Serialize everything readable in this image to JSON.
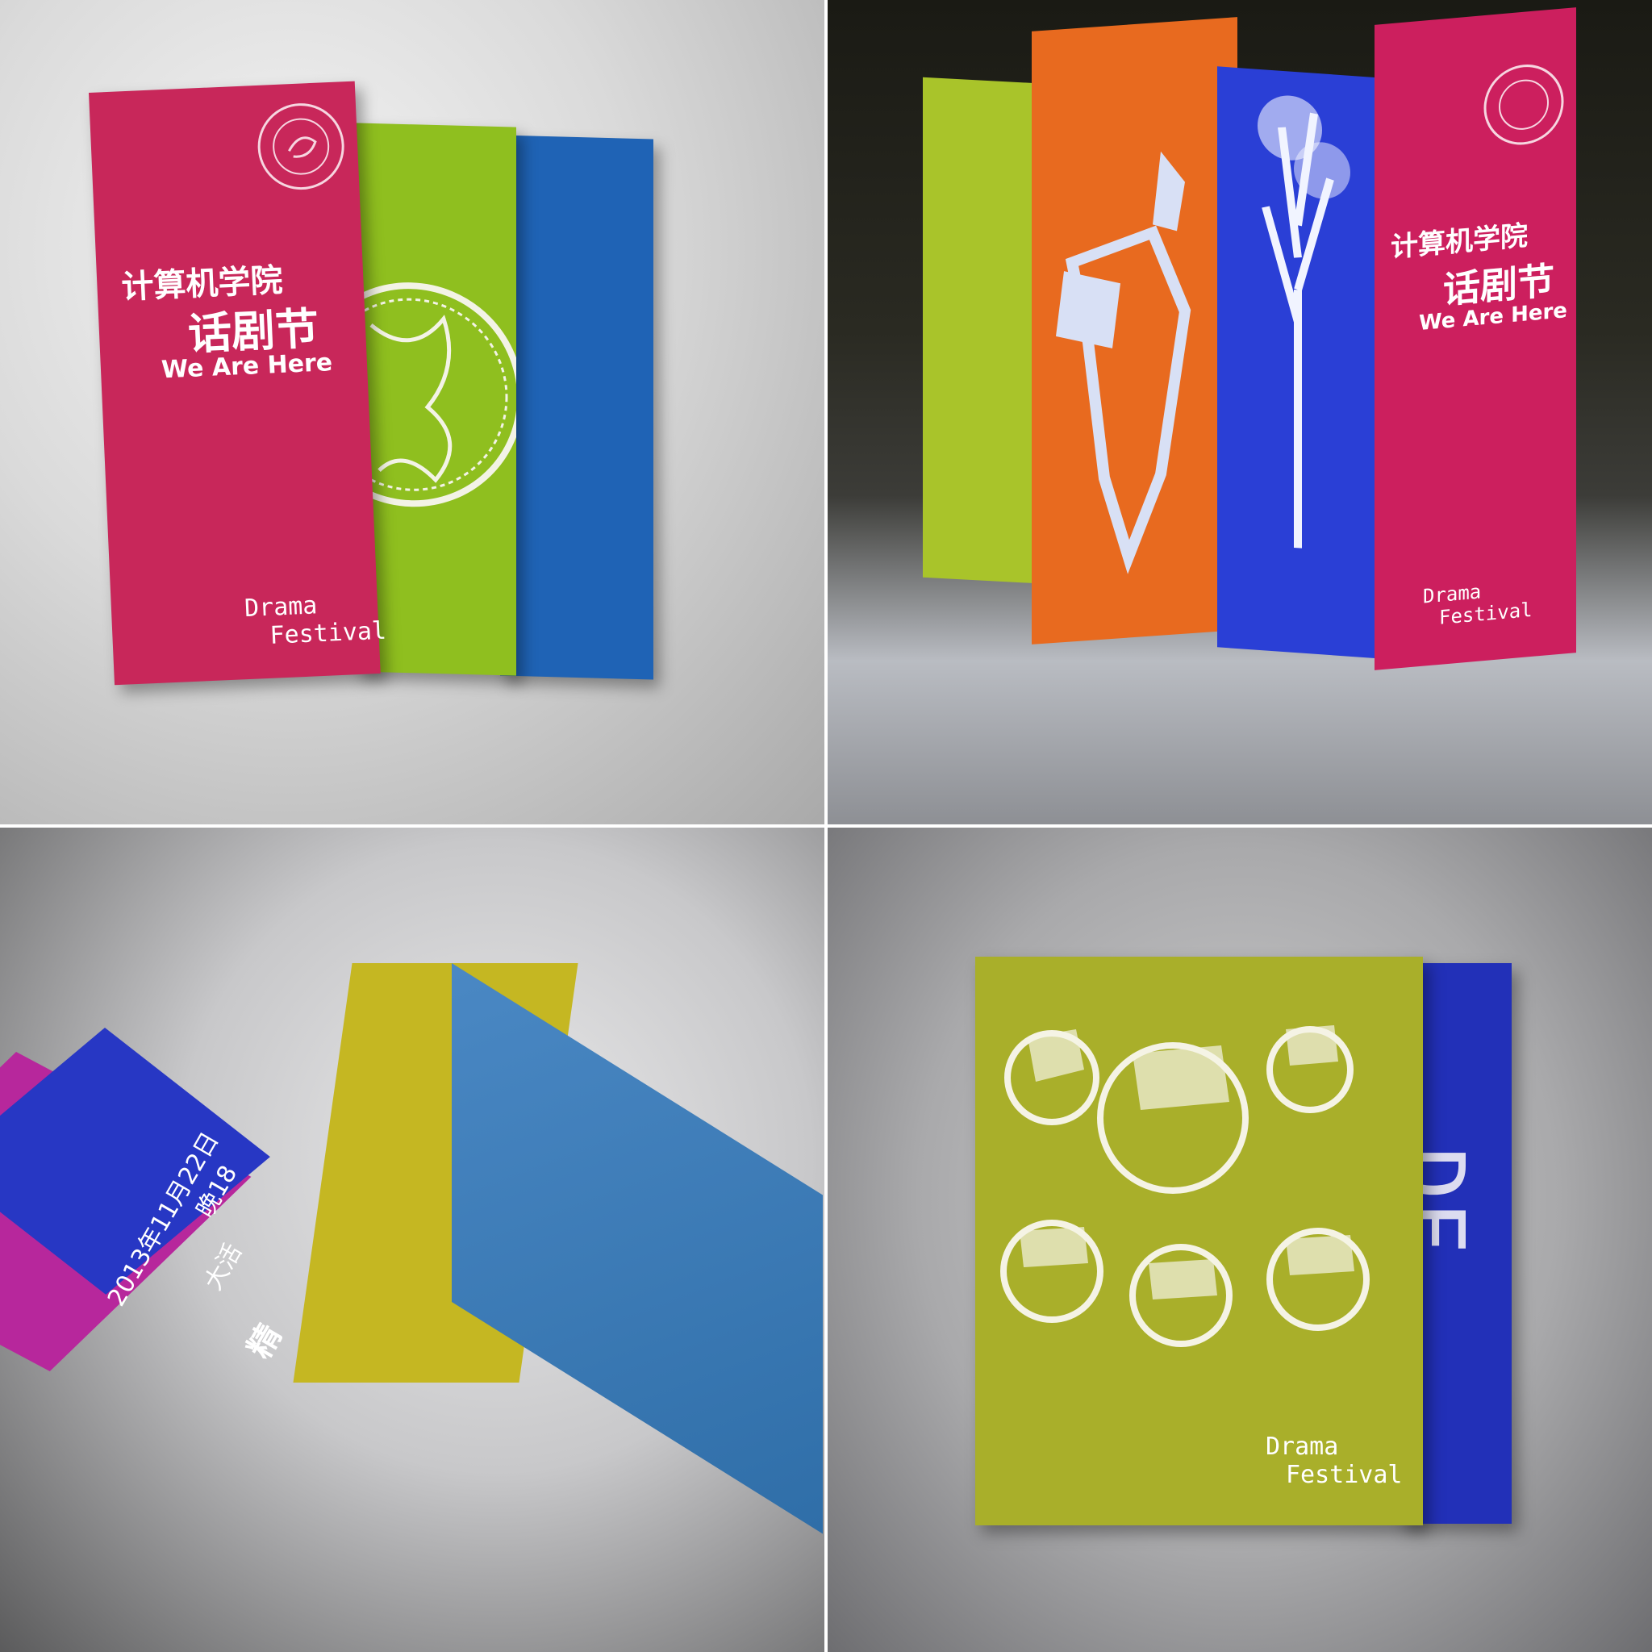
{
  "cover": {
    "school": "计算机学院",
    "event": "话剧节",
    "tagline": "We Are Here",
    "drama": "Drama",
    "festival": "Festival"
  },
  "inside": {
    "date": "2013年11月22日",
    "time_partial": "晚18",
    "venue_partial": "大活",
    "extra_partial": "精"
  },
  "back": {
    "initials": "DF",
    "drama": "Drama",
    "festival": "Festival"
  },
  "colors": {
    "magenta": "#c8275a",
    "lime": "#8fbf1f",
    "blue": "#2060b8",
    "orange": "#e86a1f",
    "royal_blue": "#2636c8",
    "purple": "#b7279c",
    "mustard": "#b8b51f"
  }
}
